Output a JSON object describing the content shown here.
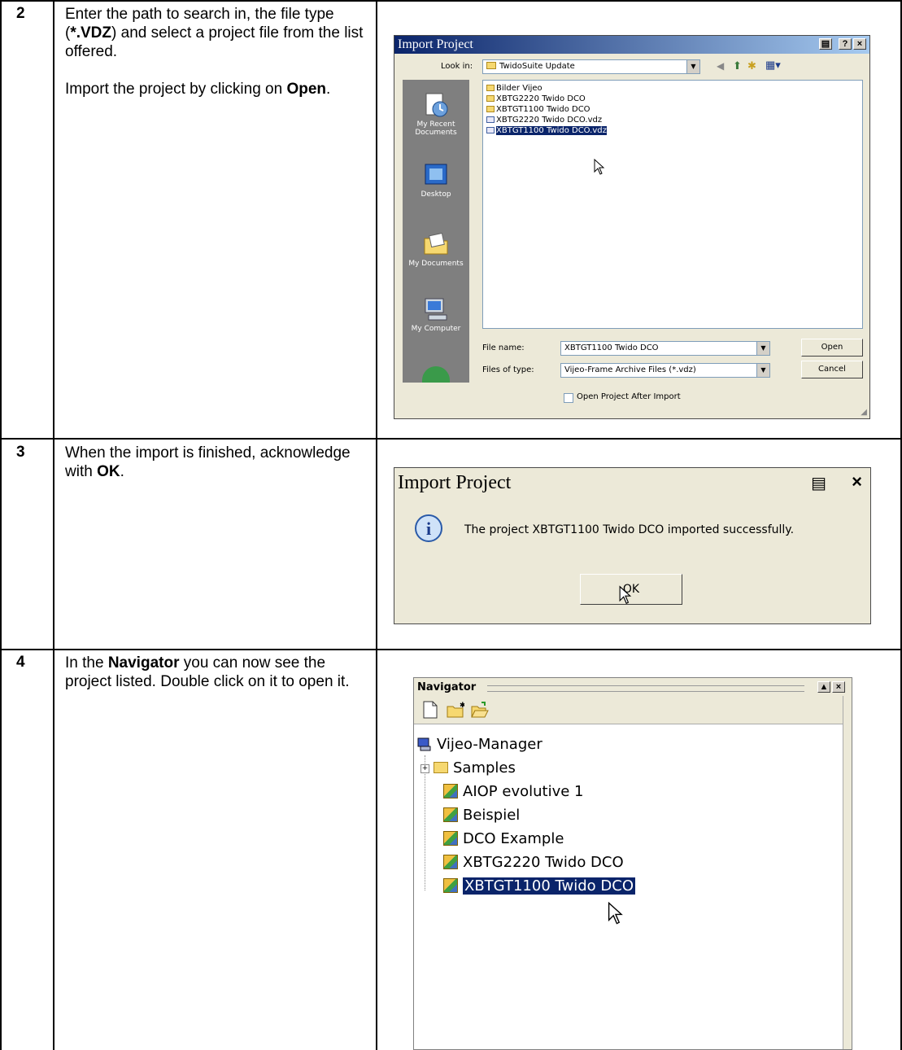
{
  "steps": [
    {
      "number": "2",
      "paragraphs": [
        [
          "Enter the path to search in, the file type (",
          "*.VDZ",
          ") and select a project file from the list offered."
        ],
        [
          "Import the project by clicking on ",
          "Open",
          "."
        ]
      ]
    },
    {
      "number": "3",
      "paragraphs": [
        [
          "When the import is finished, acknowledge with ",
          "OK",
          "."
        ]
      ]
    },
    {
      "number": "4",
      "paragraphs": [
        [
          "In the ",
          "Navigator",
          " you can now see the project listed. Double click on it to open it."
        ]
      ]
    }
  ],
  "open_dialog": {
    "title": "Import Project",
    "help_button": "?",
    "close_button": "×",
    "look_in_label": "Look in:",
    "look_in_value": "TwidoSuite Update",
    "places": [
      "My Recent Documents",
      "Desktop",
      "My Documents",
      "My Computer"
    ],
    "files": [
      {
        "name": "Bilder Vijeo",
        "kind": "folder"
      },
      {
        "name": "XBTG2220 Twido DCO",
        "kind": "folder"
      },
      {
        "name": "XBTGT1100 Twido DCO",
        "kind": "folder"
      },
      {
        "name": "XBTG2220 Twido DCO.vdz",
        "kind": "vdz"
      },
      {
        "name": "XBTGT1100 Twido DCO.vdz",
        "kind": "vdz",
        "selected": true
      }
    ],
    "file_name_label": "File name:",
    "file_name_value": "XBTGT1100 Twido DCO",
    "file_type_label": "Files of type:",
    "file_type_value": "Vijeo-Frame Archive Files (*.vdz)",
    "open_button": "Open",
    "cancel_button": "Cancel",
    "checkbox_label": "Open Project After Import"
  },
  "success_dialog": {
    "title": "Import Project",
    "close_button": "×",
    "message": "The project XBTGT1100 Twido DCO imported successfully.",
    "ok_button": "OK"
  },
  "navigator": {
    "title": "Navigator",
    "root": "Vijeo-Manager",
    "items": [
      "Samples",
      "AIOP evolutive 1",
      "Beispiel",
      "DCO Example",
      "XBTG2220 Twido DCO",
      "XBTGT1100 Twido DCO"
    ],
    "selected_index": 5
  }
}
